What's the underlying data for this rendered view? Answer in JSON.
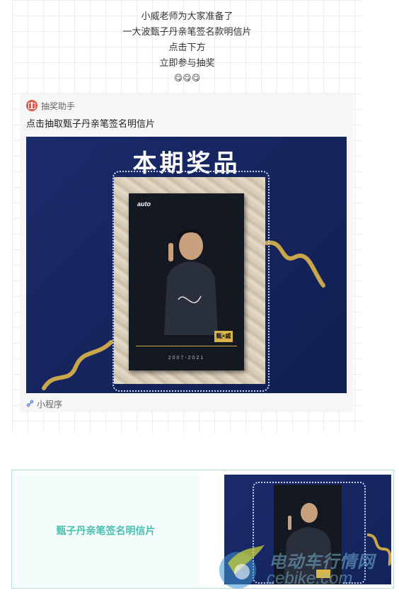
{
  "intro": {
    "lines": [
      "小威老师为大家准备了",
      "一大波甄子丹亲笔签名款明信片",
      "点击下方",
      "立即参与抽奖"
    ],
    "emojis": "😋😋😋"
  },
  "card": {
    "app_name": "抽奖助手",
    "title": "点击抽取甄子丹亲笔签名明信片",
    "banner_title": "本期奖品",
    "postcard_logo": "auto",
    "postcard_years": "2007-2021",
    "postcard_badge": "甄×威",
    "footer_label": "小程序",
    "icons": {
      "app": "gift-icon",
      "footer": "link-icon"
    }
  },
  "promo": {
    "label": "甄子丹亲笔签名明信片"
  },
  "watermark": {
    "text_cn": "电动车行情网",
    "text_en": "cebike.com"
  },
  "colors": {
    "navy": "#1b2b6b",
    "teal": "#4bbfb0",
    "gift_red": "#e0574b"
  }
}
